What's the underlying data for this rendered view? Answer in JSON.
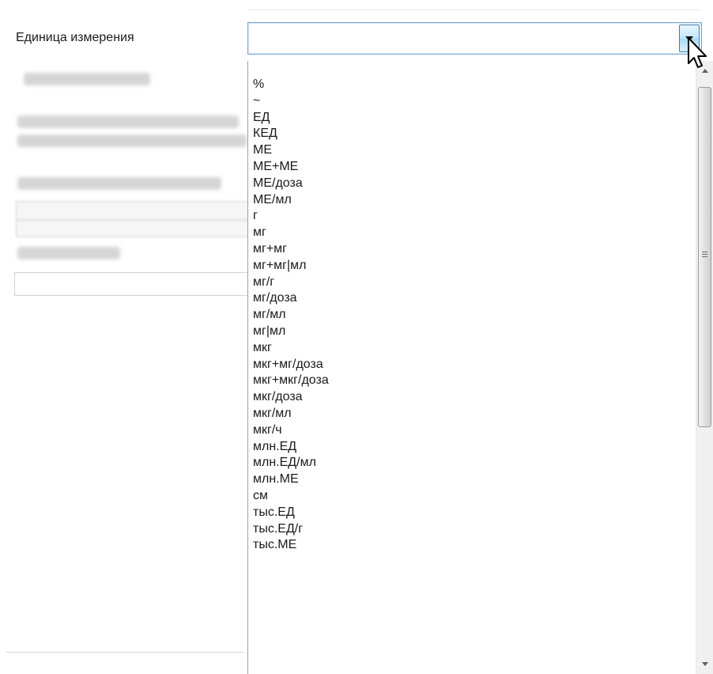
{
  "form": {
    "unit_label": "Единица измерения",
    "unit_value": ""
  },
  "dropdown": {
    "options": [
      "%",
      "~",
      "ЕД",
      "КЕД",
      "МЕ",
      "МЕ+МЕ",
      "МЕ/доза",
      "МЕ/мл",
      "г",
      "мг",
      "мг+мг",
      "мг+мг|мл",
      "мг/г",
      "мг/доза",
      "мг/мл",
      "мг|мл",
      "мкг",
      "мкг+мг/доза",
      "мкг+мкг/доза",
      "мкг/доза",
      "мкг/мл",
      "мкг/ч",
      "млн.ЕД",
      "млн.ЕД/мл",
      "млн.МЕ",
      "см",
      "тыс.ЕД",
      "тыс.ЕД/г",
      "тыс.МЕ"
    ],
    "scroll_position": 0.0
  },
  "icons": {
    "combo_button": "chevron-down-icon",
    "cursor": "mouse-pointer-icon",
    "scroll_up": "scroll-up-arrow-icon",
    "scroll_down": "scroll-down-arrow-icon"
  },
  "colors": {
    "combo_border": "#7ba6d6",
    "combo_button_border": "#3c7fb1",
    "list_border": "#a0a0a0",
    "text": "#1a1a1a"
  }
}
